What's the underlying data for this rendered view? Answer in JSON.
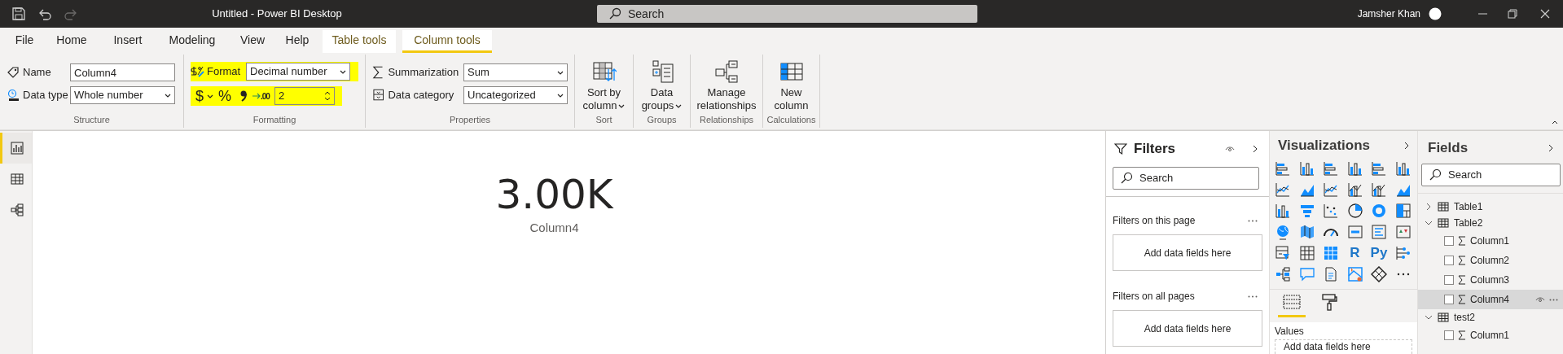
{
  "window": {
    "title": "Untitled - Power BI Desktop",
    "search_placeholder": "Search",
    "user": "Jamsher Khan"
  },
  "quick_access": [
    {
      "kind": "save",
      "disabled": false
    },
    {
      "kind": "undo",
      "disabled": false
    },
    {
      "kind": "redo",
      "disabled": true
    }
  ],
  "menu_tabs": [
    {
      "label": "File",
      "selected": false,
      "contextual": false
    },
    {
      "label": "Home",
      "selected": false,
      "contextual": false
    },
    {
      "label": "Insert",
      "selected": false,
      "contextual": false
    },
    {
      "label": "Modeling",
      "selected": false,
      "contextual": false
    },
    {
      "label": "View",
      "selected": false,
      "contextual": false
    },
    {
      "label": "Help",
      "selected": false,
      "contextual": false
    },
    {
      "label": "Table tools",
      "selected": false,
      "contextual": true
    },
    {
      "label": "Column tools",
      "selected": true,
      "contextual": true
    }
  ],
  "ribbon": {
    "structure": {
      "label": "Structure",
      "name_label": "Name",
      "name_value": "Column4",
      "data_type_label": "Data type",
      "data_type_value": "Whole number"
    },
    "formatting": {
      "label": "Formatting",
      "format_label": "Format",
      "format_value": "Decimal number",
      "currency_symbol": "$",
      "percent_symbol": "%",
      "decimal_marker": ".00",
      "decimal_places": "2",
      "highlighted": true
    },
    "properties": {
      "label": "Properties",
      "summarization_label": "Summarization",
      "summarization_value": "Sum",
      "category_label": "Data category",
      "category_value": "Uncategorized"
    },
    "command_groups": [
      {
        "label": "Sort",
        "kind": "sort",
        "lines": [
          "Sort by",
          "column"
        ],
        "dropdown": true
      },
      {
        "label": "Groups",
        "kind": "groups",
        "lines": [
          "Data",
          "groups"
        ],
        "dropdown": true
      },
      {
        "label": "Relationships",
        "kind": "relationships",
        "lines": [
          "Manage",
          "relationships"
        ],
        "dropdown": false
      },
      {
        "label": "Calculations",
        "kind": "new_column",
        "lines": [
          "New",
          "column"
        ],
        "dropdown": false
      }
    ]
  },
  "left_nav": [
    {
      "kind": "report",
      "selected": true
    },
    {
      "kind": "data",
      "selected": false
    },
    {
      "kind": "model",
      "selected": false
    }
  ],
  "card": {
    "value": "3.00K",
    "label": "Column4"
  },
  "filters": {
    "title": "Filters",
    "search_placeholder": "Search",
    "sections": [
      {
        "title": "Filters on this page",
        "drop_hint": "Add data fields here"
      },
      {
        "title": "Filters on all pages",
        "drop_hint": "Add data fields here"
      }
    ]
  },
  "visualizations": {
    "title": "Visualizations",
    "text_visuals": [
      "R",
      "Py"
    ],
    "pane_tabs": [
      {
        "kind": "fields",
        "selected": true
      },
      {
        "kind": "format",
        "selected": false
      }
    ],
    "well": {
      "label": "Values",
      "drop_hint": "Add data fields here"
    }
  },
  "fields": {
    "title": "Fields",
    "search_placeholder": "Search",
    "tables": [
      {
        "name": "Table1",
        "expanded": false
      },
      {
        "name": "Table2",
        "expanded": true,
        "columns": [
          {
            "name": "Column1",
            "checked": false,
            "selected": false
          },
          {
            "name": "Column2",
            "checked": false,
            "selected": false
          },
          {
            "name": "Column3",
            "checked": false,
            "selected": false
          },
          {
            "name": "Column4",
            "checked": false,
            "selected": true
          }
        ]
      },
      {
        "name": "test2",
        "expanded": true,
        "columns": [
          {
            "name": "Column1",
            "checked": false,
            "selected": false
          }
        ]
      }
    ]
  }
}
